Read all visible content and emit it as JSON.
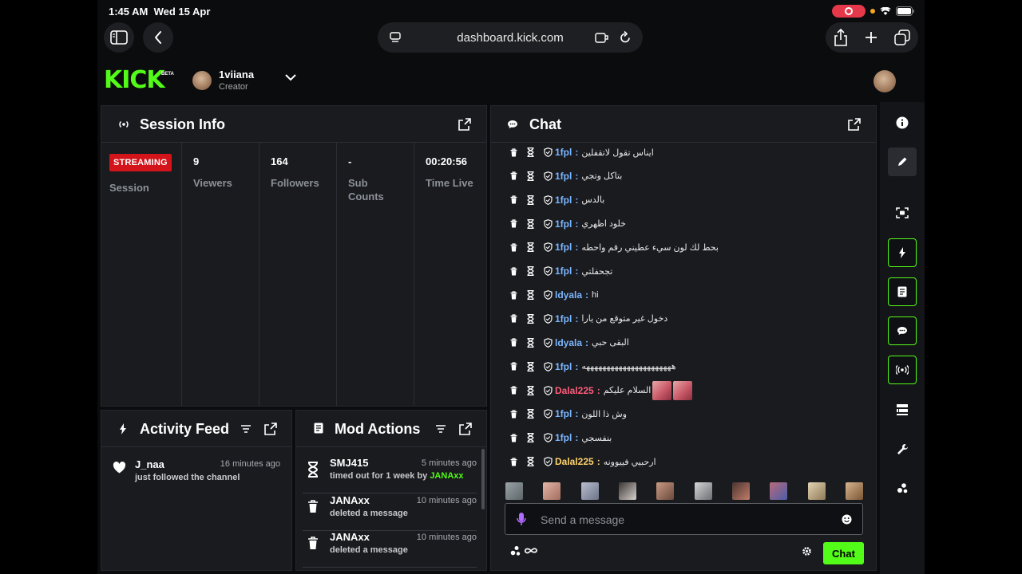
{
  "status_bar": {
    "time": "1:45 AM",
    "date": "Wed 15 Apr"
  },
  "browser": {
    "url": "dashboard.kick.com"
  },
  "app": {
    "logo": "KICK",
    "beta": "BETA",
    "user": {
      "name": "1viiana",
      "role": "Creator"
    }
  },
  "session": {
    "title": "Session Info",
    "status_badge": "STREAMING",
    "session_label": "Session",
    "stats": [
      {
        "value": "9",
        "label": "Viewers"
      },
      {
        "value": "164",
        "label": "Followers"
      },
      {
        "value": "-",
        "label": "Sub\nCounts"
      },
      {
        "value": "00:20:56",
        "label": "Time Live"
      }
    ]
  },
  "activity": {
    "title": "Activity Feed",
    "items": [
      {
        "name": "J_naa",
        "time": "16 minutes ago",
        "desc": "just followed the channel"
      }
    ]
  },
  "mod_actions": {
    "title": "Mod Actions",
    "items": [
      {
        "name": "SMJ415",
        "time": "5 minutes ago",
        "desc": "timed out for 1 week by",
        "by": "JANAxx",
        "icon": "hourglass-icon"
      },
      {
        "name": "JANAxx",
        "time": "10 minutes ago",
        "desc": "deleted a message",
        "icon": "trash-icon"
      },
      {
        "name": "JANAxx",
        "time": "10 minutes ago",
        "desc": "deleted a message",
        "icon": "trash-icon"
      }
    ]
  },
  "chat": {
    "title": "Chat",
    "messages": [
      {
        "user": "1fpl",
        "color": "#7cb6ff",
        "text": "ايناس تقول لاتقفلين"
      },
      {
        "user": "1fpl",
        "color": "#7cb6ff",
        "text": "بتاكل وتجي"
      },
      {
        "user": "1fpl",
        "color": "#7cb6ff",
        "text": "بالدس"
      },
      {
        "user": "1fpl",
        "color": "#7cb6ff",
        "text": "خلود اظهري"
      },
      {
        "user": "1fpl",
        "color": "#7cb6ff",
        "text": "بحط لك لون سيء عطيني رقم واحطه"
      },
      {
        "user": "1fpl",
        "color": "#7cb6ff",
        "text": "تجحفلتي"
      },
      {
        "user": "ldyala",
        "color": "#7cb6ff",
        "text": "hi"
      },
      {
        "user": "1fpl",
        "color": "#7cb6ff",
        "text": "دخول غير متوقع من يارا"
      },
      {
        "user": "ldyala",
        "color": "#7cb6ff",
        "text": "البقى حبي"
      },
      {
        "user": "1fpl",
        "color": "#7cb6ff",
        "text": "ههههههههههههههههههههههه"
      },
      {
        "user": "Dalal225",
        "color": "#ff5c7a",
        "text": "السلام عليكم"
      },
      {
        "user": "1fpl",
        "color": "#7cb6ff",
        "text": "وش ذا اللون"
      },
      {
        "user": "1fpl",
        "color": "#7cb6ff",
        "text": "بنفسجي"
      },
      {
        "user": "Dalal225",
        "color": "#ffd36b",
        "text": "ارحبيي فييوونه"
      }
    ],
    "input_placeholder": "Send a message",
    "send_label": "Chat"
  },
  "colors": {
    "accent": "#53fc18",
    "live": "#d3141a",
    "panel": "#191b1f"
  }
}
